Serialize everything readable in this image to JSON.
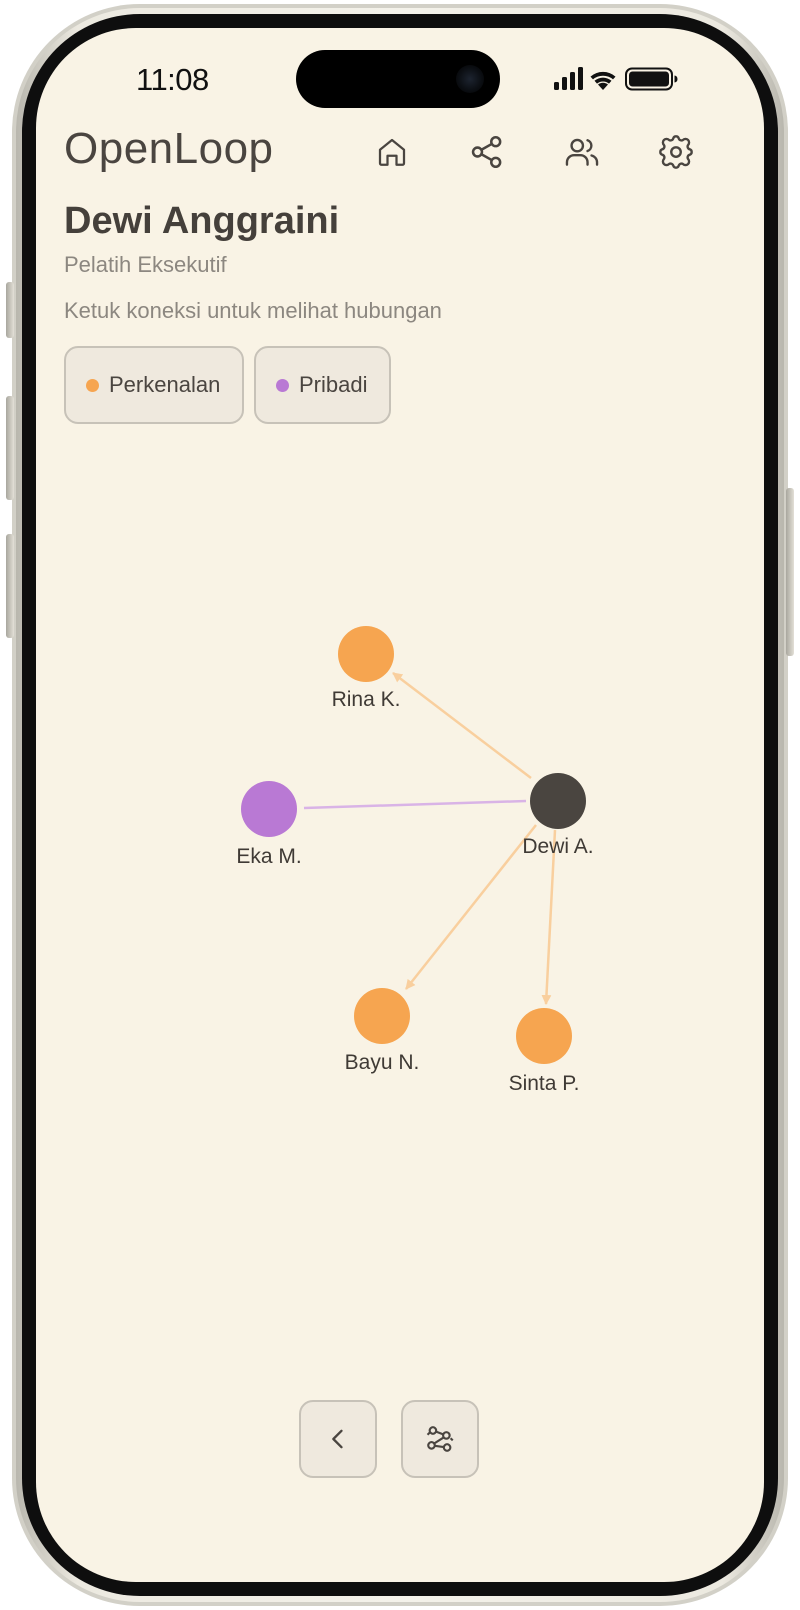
{
  "status_bar": {
    "time": "11:08"
  },
  "app": {
    "logo": "OpenLoop"
  },
  "nav": {
    "icons": [
      "home-icon",
      "share-icon",
      "users-icon",
      "gear-icon"
    ]
  },
  "profile": {
    "name": "Dewi Anggraini",
    "role": "Pelatih Eksekutif"
  },
  "hint": "Ketuk koneksi untuk melihat hubungan",
  "filters": [
    {
      "label": "Perkenalan",
      "color": "#f6a550"
    },
    {
      "label": "Pribadi",
      "color": "#b979d4"
    }
  ],
  "graph": {
    "center": {
      "label": "Dewi A.",
      "color": "#4a4540"
    },
    "nodes": [
      {
        "label": "Rina K.",
        "type": "Perkenalan",
        "color": "#f6a550"
      },
      {
        "label": "Eka M.",
        "type": "Pribadi",
        "color": "#b979d4"
      },
      {
        "label": "Bayu N.",
        "type": "Perkenalan",
        "color": "#f6a550"
      },
      {
        "label": "Sinta P.",
        "type": "Perkenalan",
        "color": "#f6a550"
      }
    ],
    "edge_colors": {
      "Perkenalan": "#f9cf9e",
      "Pribadi": "#d9b3e6"
    }
  },
  "bottom_actions": [
    "back-icon",
    "graph-layout-icon"
  ]
}
